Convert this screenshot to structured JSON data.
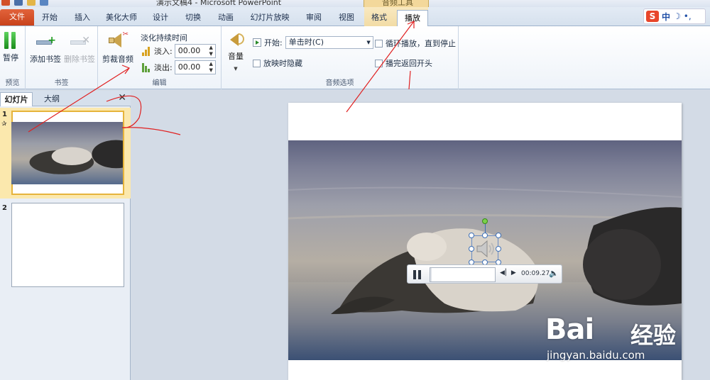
{
  "window": {
    "title": "演示文稿4 - Microsoft PowerPoint",
    "context_tab_group": "音频工具"
  },
  "tabs": [
    {
      "label": "文件"
    },
    {
      "label": "开始"
    },
    {
      "label": "插入"
    },
    {
      "label": "美化大师"
    },
    {
      "label": "设计"
    },
    {
      "label": "切换"
    },
    {
      "label": "动画"
    },
    {
      "label": "幻灯片放映"
    },
    {
      "label": "审阅"
    },
    {
      "label": "视图"
    },
    {
      "label": "格式"
    },
    {
      "label": "播放"
    }
  ],
  "ime": {
    "label": "中"
  },
  "ribbon": {
    "preview": {
      "pause_label": "暂停",
      "group_label": "预览"
    },
    "bookmarks": {
      "add_label": "添加书签",
      "remove_label": "删除书签",
      "group_label": "书签"
    },
    "editing": {
      "trim_label": "剪裁音频",
      "fade_title": "淡化持续时间",
      "fade_in_label": "淡入:",
      "fade_in_value": "00.00",
      "fade_out_label": "淡出:",
      "fade_out_value": "00.00",
      "group_label": "编辑"
    },
    "audio_options": {
      "volume_label": "音量",
      "start_label": "开始:",
      "start_value": "单击时(C)",
      "hide_label": "放映时隐藏",
      "loop_label": "循环播放，直到停止",
      "rewind_label": "播完返回开头",
      "group_label": "音频选项"
    }
  },
  "pane": {
    "tab_slides": "幻灯片",
    "tab_outline": "大纲",
    "slides": [
      {
        "number": "1",
        "marker": "✰"
      },
      {
        "number": "2"
      }
    ]
  },
  "player": {
    "time": "00:09.27",
    "progress": 0.02
  },
  "watermark": {
    "logo": "Bai",
    "cn": "经验",
    "url": "jingyan.baidu.com"
  },
  "colors": {
    "accent_file": "#d2512a",
    "annotation_red": "#e02020",
    "play_tab": "#ffffff"
  }
}
